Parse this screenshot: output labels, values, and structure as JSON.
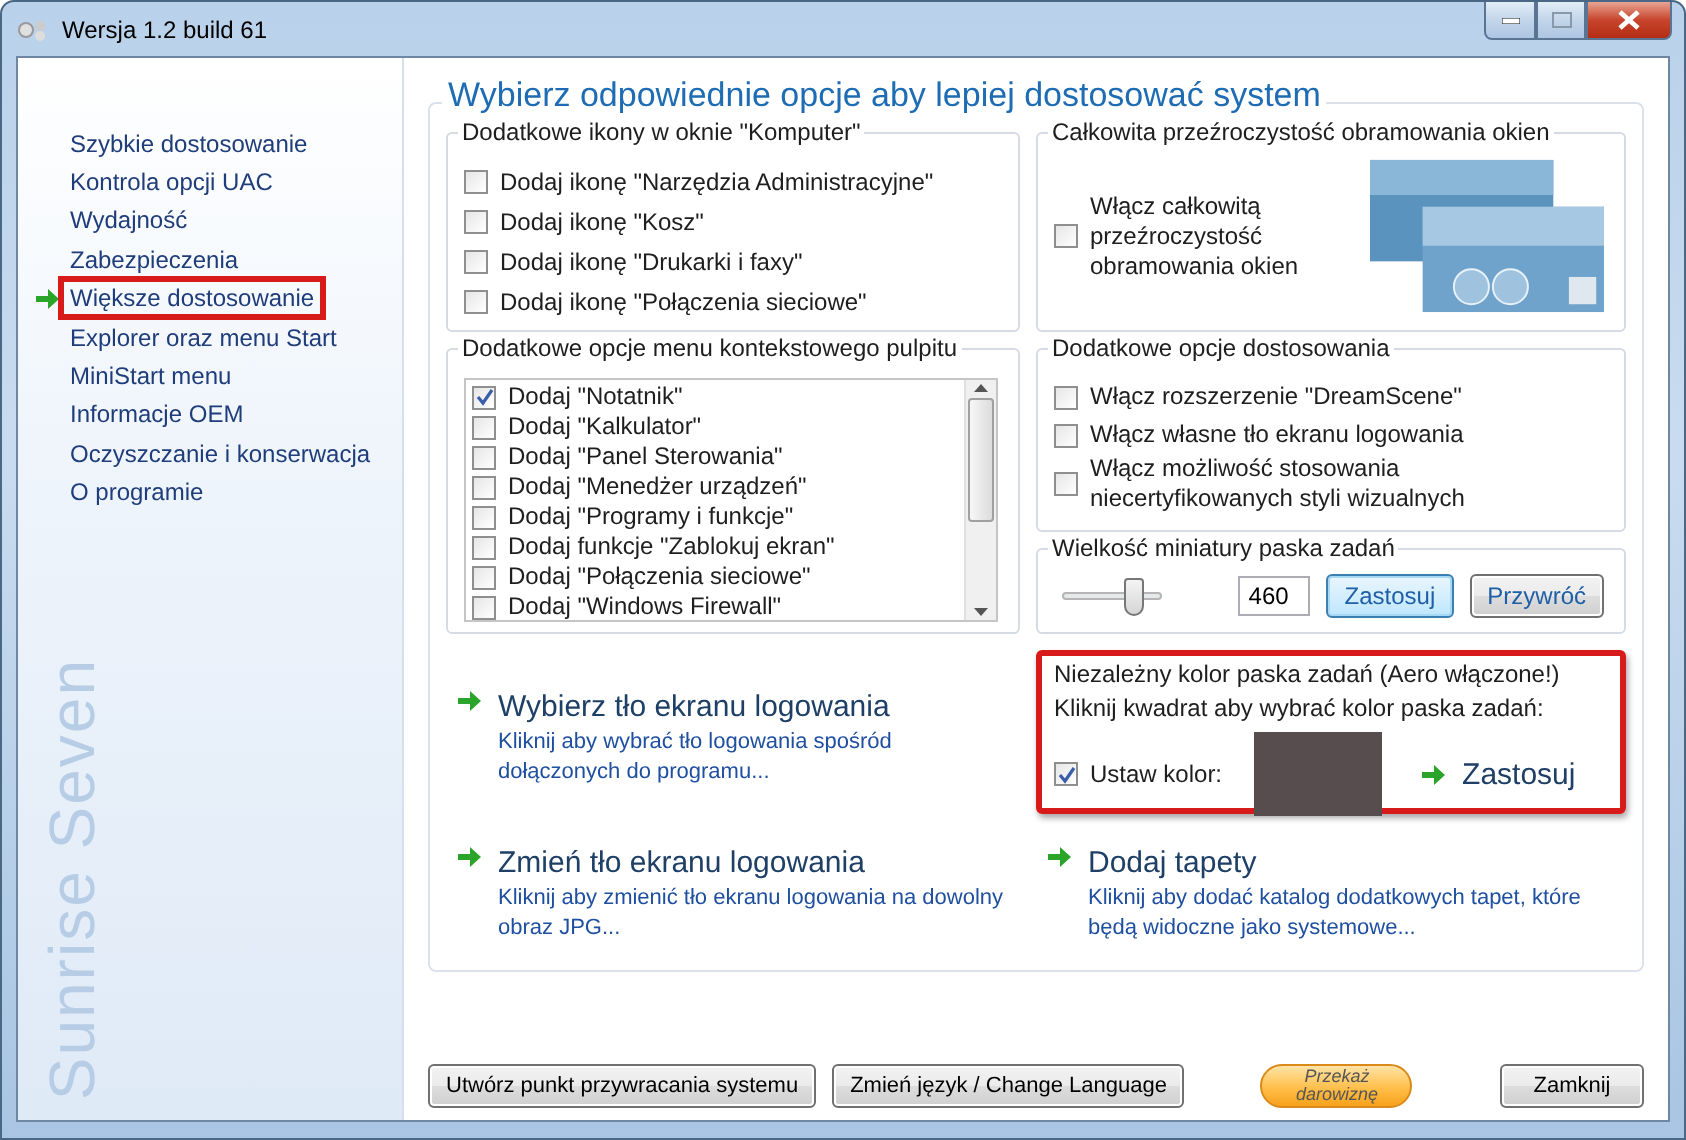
{
  "window": {
    "title": "Wersja 1.2 build 61"
  },
  "sidebar": {
    "brand": "Sunrise Seven",
    "items": [
      {
        "label": "Szybkie dostosowanie",
        "selected": false
      },
      {
        "label": "Kontrola opcji UAC",
        "selected": false
      },
      {
        "label": "Wydajność",
        "selected": false
      },
      {
        "label": "Zabezpieczenia",
        "selected": false
      },
      {
        "label": "Większe dostosowanie",
        "selected": true
      },
      {
        "label": "Explorer oraz menu Start",
        "selected": false
      },
      {
        "label": "MiniStart menu",
        "selected": false
      },
      {
        "label": "Informacje OEM",
        "selected": false
      },
      {
        "label": "Oczyszczanie i konserwacja",
        "selected": false
      },
      {
        "label": "O programie",
        "selected": false
      }
    ]
  },
  "heading": "Wybierz odpowiednie opcje aby lepiej dostosować system",
  "icons_group": {
    "title": "Dodatkowe ikony w oknie \"Komputer\"",
    "options": [
      {
        "label": "Dodaj ikonę \"Narzędzia Administracyjne\"",
        "checked": false
      },
      {
        "label": "Dodaj ikonę \"Kosz\"",
        "checked": false
      },
      {
        "label": "Dodaj ikonę \"Drukarki i faxy\"",
        "checked": false
      },
      {
        "label": "Dodaj ikonę \"Połączenia sieciowe\"",
        "checked": false
      }
    ]
  },
  "transparency_group": {
    "title": "Całkowita przeźroczystość obramowania okien",
    "option": {
      "label": "Włącz całkowitą przeźroczystość obramowania okien",
      "checked": false
    }
  },
  "context_menu_group": {
    "title": "Dodatkowe opcje menu kontekstowego pulpitu",
    "options": [
      {
        "label": "Dodaj \"Notatnik\"",
        "checked": true
      },
      {
        "label": "Dodaj \"Kalkulator\"",
        "checked": false
      },
      {
        "label": "Dodaj \"Panel Sterowania\"",
        "checked": false
      },
      {
        "label": "Dodaj \"Menedżer urządzeń\"",
        "checked": false
      },
      {
        "label": "Dodaj \"Programy i funkcje\"",
        "checked": false
      },
      {
        "label": "Dodaj funkcje \"Zablokuj ekran\"",
        "checked": false
      },
      {
        "label": "Dodaj \"Połączenia sieciowe\"",
        "checked": false
      },
      {
        "label": "Dodaj \"Windows Firewall\"",
        "checked": false
      }
    ]
  },
  "customization_group": {
    "title": "Dodatkowe opcje dostosowania",
    "options": [
      {
        "label": "Włącz rozszerzenie \"DreamScene\"",
        "checked": false
      },
      {
        "label": "Włącz własne tło ekranu logowania",
        "checked": false
      },
      {
        "label": "Włącz możliwość stosowania niecertyfikowanych styli wizualnych",
        "checked": false
      }
    ]
  },
  "thumbnail_group": {
    "title": "Wielkość miniatury paska zadań",
    "slider": {
      "level": 0.72
    },
    "value": "460",
    "buttons": [
      {
        "label": "Zastosuj",
        "focused": true
      },
      {
        "label": "Przywróć",
        "focused": false
      }
    ]
  },
  "taskbar_color": {
    "title": "Niezależny kolor paska zadań (Aero włączone!)",
    "hint": "Kliknij kwadrat aby wybrać kolor paska zadań:",
    "checkbox": {
      "label": "Ustaw kolor:",
      "checked": true
    },
    "swatch": {
      "color": "#574d4f"
    },
    "apply": "Zastosuj",
    "highlighted": true
  },
  "links": [
    {
      "title": "Wybierz tło ekranu logowania",
      "description": "Kliknij aby wybrać tło logowania spośród dołączonych do programu..."
    },
    {
      "title": "Zmień tło ekranu logowania",
      "description": "Kliknij aby zmienić tło ekranu logowania na dowolny obraz JPG..."
    },
    {
      "title": "Dodaj tapety",
      "description": "Kliknij aby dodać katalog dodatkowych tapet, które będą widoczne jako systemowe..."
    }
  ],
  "footer": {
    "buttons": [
      {
        "label": "Utwórz punkt przywracania systemu",
        "kind": "default"
      },
      {
        "label": "Zmień język / Change Language",
        "kind": "default"
      },
      {
        "label": "Przekaż darowiznę",
        "kind": "donate"
      },
      {
        "label": "Zamknij",
        "kind": "default"
      }
    ]
  }
}
